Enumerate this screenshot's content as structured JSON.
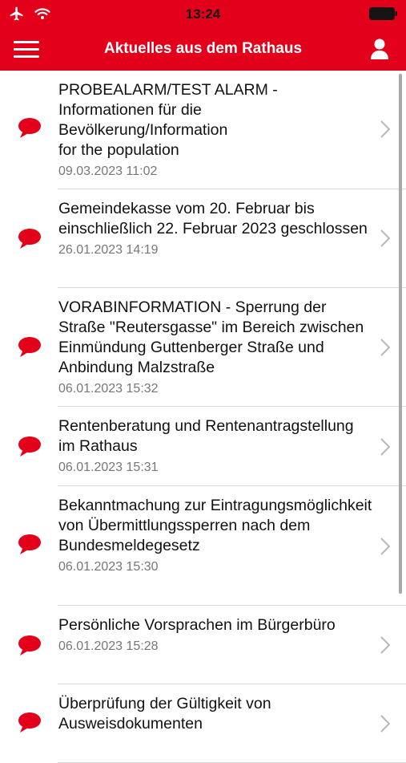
{
  "status_bar": {
    "time": "13:24",
    "icons": [
      "airplane-icon",
      "wifi-icon",
      "battery-icon"
    ]
  },
  "header": {
    "title": "Aktuelles aus dem Rathaus",
    "menu_icon": "hamburger-menu-icon",
    "profile_icon": "user-icon"
  },
  "colors": {
    "brand": "#e2001a",
    "text": "#111111",
    "date": "#777777",
    "separator": "#d9d9d9"
  },
  "news": [
    {
      "title": "PROBEALARM/TEST ALARM - Informationen für die Bevölkerung/Information\nfor the population",
      "date": "09.03.2023 11:02"
    },
    {
      "title": "Gemeindekasse vom 20. Februar bis einschließlich 22. Februar 2023 geschlossen",
      "date": "26.01.2023 14:19"
    },
    {
      "title": "VORABINFORMATION - Sperrung der Straße \"Reutersgasse\" im Bereich zwischen Einmündung Guttenberger Straße und Anbindung Malzstraße",
      "date": "06.01.2023 15:32"
    },
    {
      "title": "Rentenberatung und Rentenantragstellung im Rathaus",
      "date": "06.01.2023 15:31"
    },
    {
      "title": "Bekanntmachung zur Eintragungsmöglichkeit von Übermittlungssperren nach dem Bundesmeldegesetz",
      "date": "06.01.2023 15:30"
    },
    {
      "title": "Persönliche Vorsprachen im Bürgerbüro",
      "date": "06.01.2023 15:28"
    },
    {
      "title": "Überprüfung der Gültigkeit von Ausweisdokumenten",
      "date": ""
    }
  ]
}
